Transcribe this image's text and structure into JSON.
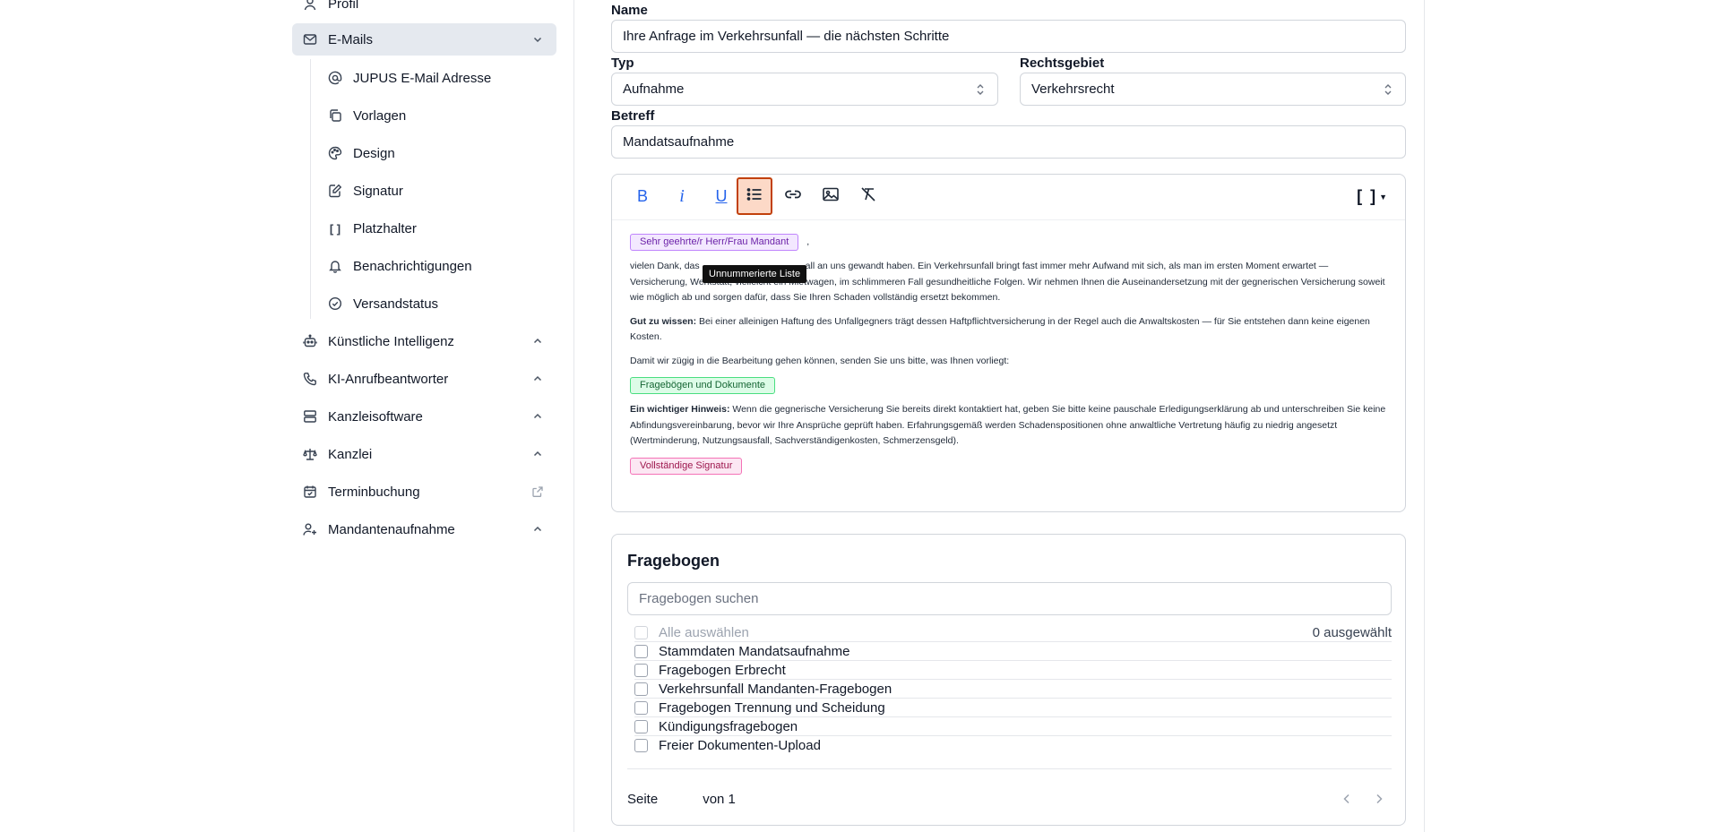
{
  "sidebar": {
    "profile_label": "Profil",
    "emails_label": "E-Mails",
    "email_sub": [
      {
        "label": "JUPUS E-Mail Adresse",
        "icon": "at-icon"
      },
      {
        "label": "Vorlagen",
        "icon": "copy-icon"
      },
      {
        "label": "Design",
        "icon": "palette-icon"
      },
      {
        "label": "Signatur",
        "icon": "signature-icon"
      },
      {
        "label": "Platzhalter",
        "icon": "brackets-icon"
      },
      {
        "label": "Benachrichtigungen",
        "icon": "bell-icon"
      },
      {
        "label": "Versandstatus",
        "icon": "check-circle-icon"
      }
    ],
    "groups": [
      {
        "label": "Künstliche Intelligenz",
        "icon": "robot-icon"
      },
      {
        "label": "KI-Anrufbeantworter",
        "icon": "phone-icon"
      },
      {
        "label": "Kanzleisoftware",
        "icon": "server-icon"
      },
      {
        "label": "Kanzlei",
        "icon": "scale-icon"
      },
      {
        "label": "Terminbuchung",
        "icon": "calendar-icon"
      },
      {
        "label": "Mandantenaufnahme",
        "icon": "user-plus-icon"
      }
    ]
  },
  "form": {
    "name_label": "Name",
    "name_value": "Ihre Anfrage im Verkehrsunfall — die nächsten Schritte",
    "typ_label": "Typ",
    "typ_value": "Aufnahme",
    "rechtsgebiet_label": "Rechtsgebiet",
    "rechtsgebiet_value": "Verkehrsrecht",
    "betreff_label": "Betreff",
    "betreff_value": "Mandatsaufnahme"
  },
  "editor": {
    "tooltip": "Unnummerierte Liste",
    "placeholder_button": "[ ]",
    "chip_greeting": "Sehr geehrte/r Herr/Frau Mandant",
    "greeting_comma": ",",
    "p1_before": "vielen Dank, das",
    "p1_after": "all an uns gewandt haben. Ein Verkehrsunfall bringt fast immer mehr Aufwand mit sich, als man im ersten Moment erwartet — Versicherung, Werkstatt, vielleicht ein Mietwagen, im schlimmeren Fall gesundheitliche Folgen. Wir nehmen Ihnen die Auseinandersetzung mit der gegnerischen Versicherung soweit wie möglich ab und sorgen dafür, dass Sie Ihren Schaden vollständig ersetzt bekommen.",
    "p2_bold": "Gut zu wissen:",
    "p2_text": " Bei einer alleinigen Haftung des Unfallgegners trägt dessen Haftpflichtversicherung in der Regel auch die Anwaltskosten — für Sie entstehen dann keine eigenen Kosten.",
    "p3_text": "Damit wir zügig in die Bearbeitung gehen können, senden Sie uns bitte, was Ihnen vorliegt:",
    "chip_docs": "Fragebögen und Dokumente",
    "p4_bold": "Ein wichtiger Hinweis:",
    "p4_text": " Wenn die gegnerische Versicherung Sie bereits direkt kontaktiert hat, geben Sie bitte keine pauschale Erledigungserklärung ab und unterschreiben Sie keine Abfindungsvereinbarung, bevor wir Ihre Ansprüche geprüft haben. Erfahrungsgemäß werden Schadenspositionen ohne anwaltliche Vertretung häufig zu niedrig angesetzt (Wertminderung, Nutzungsausfall, Sachverständigenkosten, Schmerzensgeld).",
    "chip_signature": "Vollständige Signatur"
  },
  "fragebogen": {
    "title": "Fragebogen",
    "search_placeholder": "Fragebogen suchen",
    "select_all": "Alle auswählen",
    "selected_count": "0 ausgewählt",
    "items": [
      "Stammdaten Mandatsaufnahme",
      "Fragebogen Erbrecht",
      "Verkehrsunfall Mandanten-Fragebogen",
      "Fragebogen Trennung und Scheidung",
      "Kündigungsfragebogen",
      "Freier Dokumenten-Upload"
    ],
    "page_label": "Seite",
    "page_of": "von 1"
  }
}
